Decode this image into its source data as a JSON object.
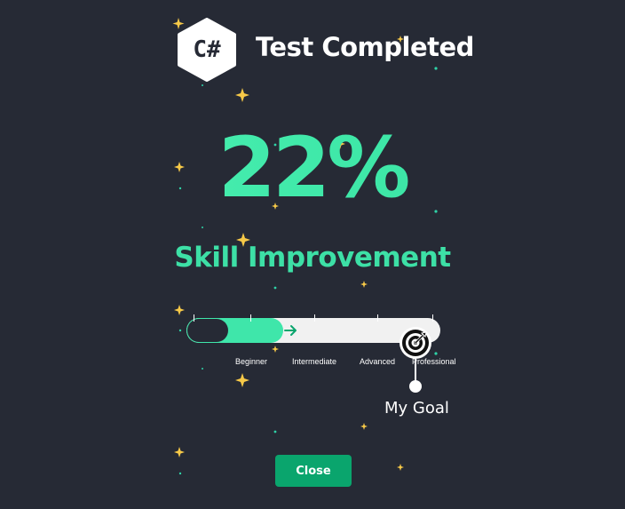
{
  "header": {
    "logo_text": "C#",
    "title": "Test Completed"
  },
  "result": {
    "percent": "22%",
    "label": "Skill Improvement"
  },
  "progress": {
    "current_fraction": 0.38,
    "levels": [
      {
        "label": "Beginner"
      },
      {
        "label": "Intermediate"
      },
      {
        "label": "Advanced"
      },
      {
        "label": "Professional"
      }
    ]
  },
  "goal": {
    "label": "My Goal",
    "icon": "target-icon"
  },
  "footer": {
    "close_label": "Close"
  },
  "colors": {
    "background": "#262a35",
    "accent": "#3fe6aa",
    "button": "#0aa56d",
    "star": "#f7c948",
    "dot": "#2fd3a7"
  }
}
